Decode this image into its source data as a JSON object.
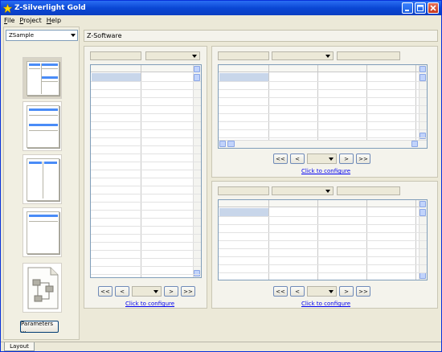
{
  "window": {
    "title": "Z-Silverlight Gold"
  },
  "menu": [
    {
      "label": "File"
    },
    {
      "label": "Project"
    },
    {
      "label": "Help"
    }
  ],
  "sidebar": {
    "project_select": "ZSample",
    "layouts": [
      {
        "name": "layout-three-panel",
        "selected": true
      },
      {
        "name": "layout-two-stacked",
        "selected": false
      },
      {
        "name": "layout-two-columns",
        "selected": false
      },
      {
        "name": "layout-single",
        "selected": false
      },
      {
        "name": "layout-diagram",
        "selected": false
      }
    ],
    "parameters_button": "Parameters ..."
  },
  "main": {
    "header": "Z-Software",
    "panels": [
      {
        "name": "left-grid-panel",
        "link": "Click to configure"
      },
      {
        "name": "top-right-grid-panel",
        "link": "Click to configure"
      },
      {
        "name": "bottom-right-grid-panel",
        "link": "Click to configure"
      }
    ],
    "nav_buttons": {
      "first": "<<",
      "prev": "<",
      "next": ">",
      "last": ">>"
    }
  },
  "status": {
    "tab": "Layout"
  },
  "colors": {
    "accent": "#4a8cf7",
    "titlebar": "#0a47d4",
    "link": "#0000ee"
  }
}
